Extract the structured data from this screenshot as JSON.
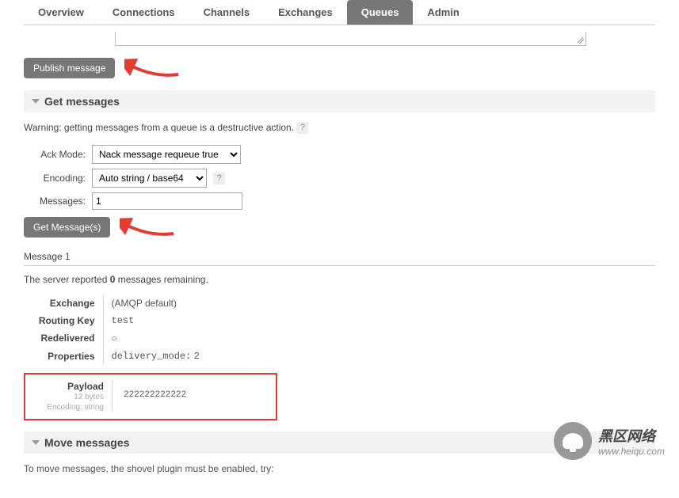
{
  "tabs": {
    "overview": "Overview",
    "connections": "Connections",
    "channels": "Channels",
    "exchanges": "Exchanges",
    "queues": "Queues",
    "admin": "Admin"
  },
  "buttons": {
    "publish": "Publish message",
    "get_messages": "Get Message(s)"
  },
  "sections": {
    "get_messages": "Get messages",
    "move_messages": "Move messages"
  },
  "warning": {
    "text": "Warning: getting messages from a queue is a destructive action.",
    "help": "?"
  },
  "form": {
    "ack_mode_label": "Ack Mode:",
    "ack_mode_value": "Nack message requeue true",
    "encoding_label": "Encoding:",
    "encoding_value": "Auto string / base64",
    "encoding_help": "?",
    "messages_label": "Messages:",
    "messages_value": "1"
  },
  "result": {
    "heading": "Message 1",
    "remaining_prefix": "The server reported ",
    "remaining_count": "0",
    "remaining_suffix": " messages remaining.",
    "rows": {
      "exchange_label": "Exchange",
      "exchange_value": "(AMQP default)",
      "routing_key_label": "Routing Key",
      "routing_key_value": "test",
      "redelivered_label": "Redelivered",
      "redelivered_value": "○",
      "properties_label": "Properties",
      "properties_key": "delivery_mode:",
      "properties_value": "2"
    },
    "payload": {
      "title": "Payload",
      "bytes": "12 bytes",
      "encoding": "Encoding: string",
      "value": "222222222222"
    }
  },
  "bottom_note": "To move messages, the shovel plugin must be enabled, try:",
  "watermark": {
    "line1": "黑区网络",
    "line2": "www.heiqu.com"
  }
}
